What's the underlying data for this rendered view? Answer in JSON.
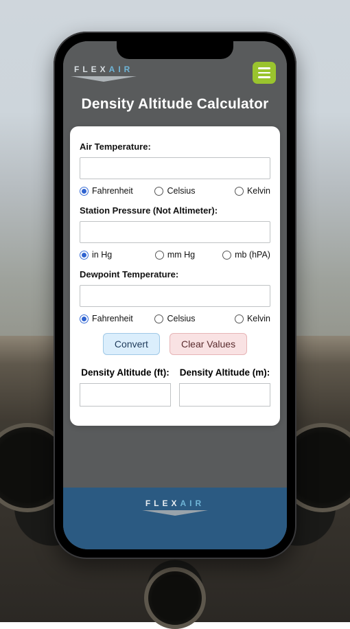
{
  "brand": {
    "left": "FLEX",
    "right": "AIR"
  },
  "menu_icon": "hamburger-icon",
  "title": "Density Altitude Calculator",
  "sections": {
    "air_temp": {
      "label": "Air Temperature:",
      "value": "",
      "options": [
        "Fahrenheit",
        "Celsius",
        "Kelvin"
      ],
      "selected": "Fahrenheit"
    },
    "pressure": {
      "label": "Station Pressure (Not Altimeter):",
      "value": "",
      "options": [
        "in Hg",
        "mm Hg",
        "mb (hPA)"
      ],
      "selected": "in Hg"
    },
    "dewpoint": {
      "label": "Dewpoint Temperature:",
      "value": "",
      "options": [
        "Fahrenheit",
        "Celsius",
        "Kelvin"
      ],
      "selected": "Fahrenheit"
    }
  },
  "buttons": {
    "convert": "Convert",
    "clear": "Clear Values"
  },
  "results": {
    "ft": {
      "label": "Density Altitude (ft):",
      "value": ""
    },
    "m": {
      "label": "Density Altitude (m):",
      "value": ""
    }
  },
  "colors": {
    "accent_green": "#9ac42e",
    "footer_blue": "#2b5a82",
    "header_gray": "#595b5c"
  }
}
